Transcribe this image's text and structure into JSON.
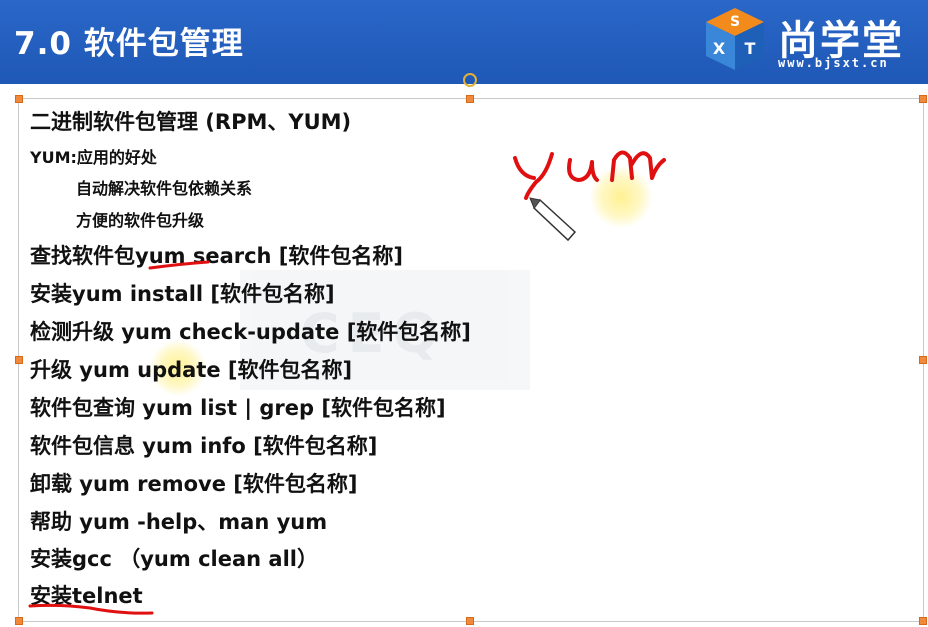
{
  "slide": {
    "title": "7.0 软件包管理"
  },
  "logo": {
    "cube_letters": [
      "S",
      "X",
      "T"
    ],
    "brand_text": "尚学堂",
    "url_text": "www.bjsxt.cn"
  },
  "content": {
    "lines": [
      {
        "text": "二进制软件包管理 (RPM、YUM)"
      },
      {
        "text": "YUM:应用的好处"
      },
      {
        "text": "自动解决软件包依赖关系"
      },
      {
        "text": "方便的软件包升级"
      },
      {
        "text": "查找软件包yum search [软件包名称]"
      },
      {
        "text": "安装yum install [软件包名称]"
      },
      {
        "text": "检测升级 yum check-update [软件包名称]"
      },
      {
        "text": "升级 yum update [软件包名称]"
      },
      {
        "text": "软件包查询 yum list | grep [软件包名称]"
      },
      {
        "text": "软件包信息 yum info [软件包名称]"
      },
      {
        "text": "卸载 yum remove [软件包名称]"
      },
      {
        "text": "帮助 yum -help、man yum"
      },
      {
        "text": "安装gcc （yum clean all）"
      },
      {
        "text": "安装telnet"
      }
    ]
  },
  "annotations": {
    "handwriting": "yum",
    "ink_color": "#e01010",
    "highlight_color": "#fff08c"
  },
  "watermark": {
    "text": "CEQ"
  },
  "colors": {
    "header_bg": "#2060bf",
    "text": "#111111",
    "handle": "#f08a3a"
  }
}
